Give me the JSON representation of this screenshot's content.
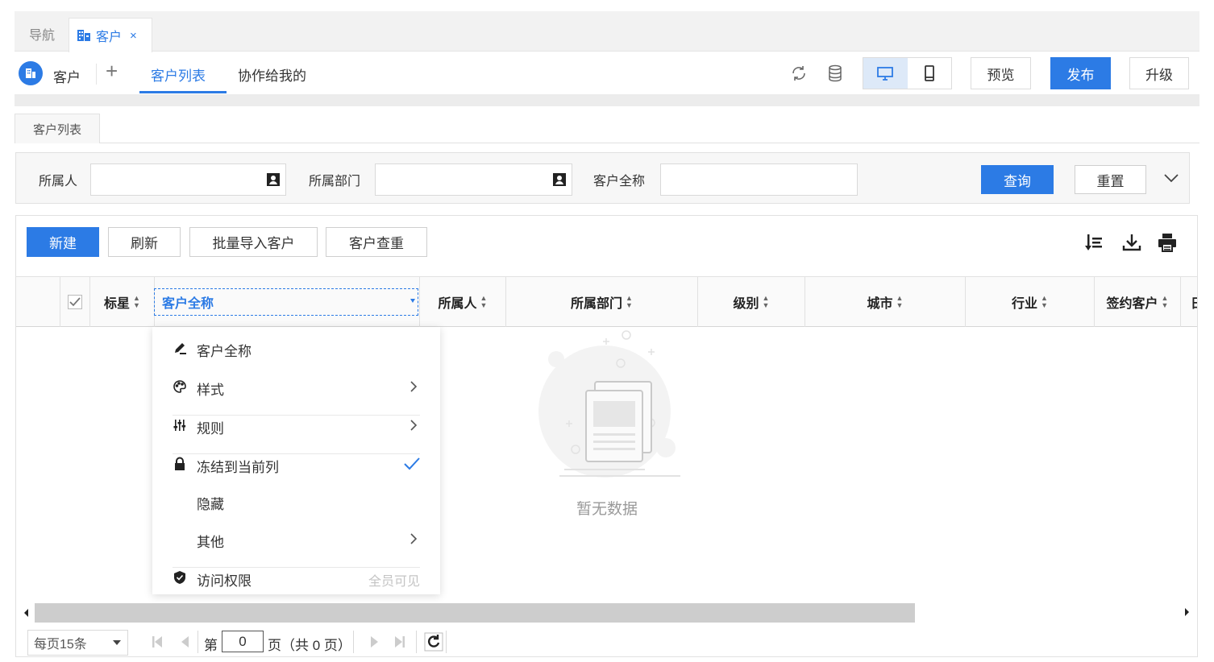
{
  "tabs": {
    "nav_label": "导航",
    "active_label": "客户",
    "close_glyph": "×"
  },
  "header": {
    "app_name": "客户",
    "plus_glyph": "+",
    "nav_tabs": [
      "客户列表",
      "协作给我的"
    ],
    "buttons": {
      "preview": "预览",
      "publish": "发布",
      "upgrade": "升级"
    },
    "icons": [
      "refresh-icon",
      "database-icon",
      "desktop-icon",
      "mobile-icon"
    ]
  },
  "page_tab": "客户列表",
  "filter": {
    "fields": [
      "所属人",
      "所属部门",
      "客户全称"
    ],
    "query": "查询",
    "reset": "重置"
  },
  "toolbar": {
    "new": "新建",
    "refresh": "刷新",
    "batch_import": "批量导入客户",
    "dedupe": "客户查重"
  },
  "table": {
    "columns": [
      "标星",
      "客户全称",
      "所属人",
      "所属部门",
      "级别",
      "城市",
      "行业",
      "签约客户"
    ],
    "partial_column": "日"
  },
  "empty_text": "暂无数据",
  "column_menu": {
    "items": [
      {
        "label": "客户全称",
        "icon": "edit-icon"
      },
      {
        "label": "样式",
        "icon": "palette-icon"
      },
      {
        "label": "规则",
        "icon": "sliders-icon"
      },
      {
        "label": "冻结到当前列",
        "icon": "lock-icon"
      },
      {
        "label": "隐藏",
        "icon": ""
      },
      {
        "label": "其他",
        "icon": ""
      },
      {
        "label": "访问权限",
        "icon": "shield-icon",
        "aux": "全员可见"
      }
    ]
  },
  "pager": {
    "page_size": "每页15条",
    "prefix": "第",
    "page": "0",
    "suffix": "页（共 0 页）"
  },
  "colors": {
    "accent": "#2c7be5"
  }
}
